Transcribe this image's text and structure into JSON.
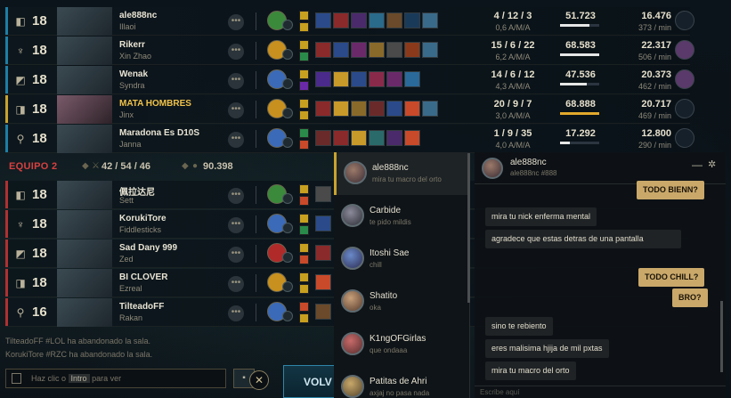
{
  "team1_players": [
    {
      "level": "18",
      "name": "ale888nc",
      "champion": "Illaoi",
      "kda": "4 / 12 / 3",
      "cs": "0,6 A/M/A",
      "damage": "51.723",
      "damage_share": 0.75,
      "gold": "16.476",
      "gold_per_min": "373 / min",
      "is_me": false
    },
    {
      "level": "18",
      "name": "Rikerr",
      "champion": "Xin Zhao",
      "kda": "15 / 6 / 22",
      "cs": "6,2 A/M/A",
      "damage": "68.583",
      "damage_share": 1.0,
      "gold": "22.317",
      "gold_per_min": "506 / min",
      "is_me": false
    },
    {
      "level": "18",
      "name": "Wenak",
      "champion": "Syndra",
      "kda": "14 / 6 / 12",
      "cs": "4,3 A/M/A",
      "damage": "47.536",
      "damage_share": 0.69,
      "gold": "20.373",
      "gold_per_min": "462 / min",
      "is_me": false
    },
    {
      "level": "18",
      "name": "MATA HOMBRES",
      "champion": "Jinx",
      "kda": "20 / 9 / 7",
      "cs": "3,0 A/M/A",
      "damage": "68.888",
      "damage_share": 1.0,
      "gold": "20.717",
      "gold_per_min": "469 / min",
      "is_me": true
    },
    {
      "level": "18",
      "name": "Maradona Es D10S",
      "champion": "Janna",
      "kda": "1 / 9 / 35",
      "cs": "4,0 A/M/A",
      "damage": "17.292",
      "damage_share": 0.25,
      "gold": "12.800",
      "gold_per_min": "290 / min",
      "is_me": false
    }
  ],
  "team2": {
    "label": "EQUIPO 2",
    "kda": "42 / 54 / 46",
    "gold": "90.398"
  },
  "team2_players": [
    {
      "level": "18",
      "name": "佩拉达尼",
      "champion": "Sett"
    },
    {
      "level": "18",
      "name": "KorukiTore",
      "champion": "Fiddlesticks"
    },
    {
      "level": "18",
      "name": "Sad Dany 999",
      "champion": "Zed"
    },
    {
      "level": "18",
      "name": "BI CLOVER",
      "champion": "Ezreal"
    },
    {
      "level": "16",
      "name": "TilteadoFF",
      "champion": "Rakan"
    }
  ],
  "system_messages": [
    "TilteadoFF #LOL ha abandonado la sala.",
    "KorukiTore #RZC ha abandonado la sala."
  ],
  "chat_input": {
    "prefix": "Haz clic o",
    "key": "Intro",
    "suffix": "para ver"
  },
  "volver_label": "VOLV",
  "friends": [
    {
      "name": "ale888nc",
      "status": "mira tu macro del orto"
    },
    {
      "name": "Carbide",
      "status": "te pido mildis"
    },
    {
      "name": "Itoshi Sae",
      "status": "chill"
    },
    {
      "name": "Shatito",
      "status": "oka"
    },
    {
      "name": "K1ngOFGirlas",
      "status": "que ondaaa"
    },
    {
      "name": "Patitas de Ahri",
      "status": "axjaj no pasa nada"
    }
  ],
  "chat": {
    "name": "ale888nc",
    "tag": "ale888nc #888",
    "messages": [
      {
        "from": "me",
        "text": "TODO BIENN?"
      },
      {
        "from": "them",
        "text": "mira tu nick enferma mental"
      },
      {
        "from": "them",
        "text": "agradece que estas detras de una pantalla"
      },
      {
        "from": "me",
        "text": "TODO CHILL?"
      },
      {
        "from": "me",
        "text": "BRO?"
      },
      {
        "from": "them",
        "text": "sino te rebiento"
      },
      {
        "from": "them",
        "text": "eres malisima hjija de mil pxtas"
      },
      {
        "from": "them",
        "text": "mira tu macro del orto"
      }
    ],
    "input_placeholder": "Escribe aquí"
  },
  "colors": {
    "team1": "#1c7fa6",
    "team2": "#b03030",
    "me": "#c8a32e",
    "accent_gold": "#c9a86a"
  }
}
